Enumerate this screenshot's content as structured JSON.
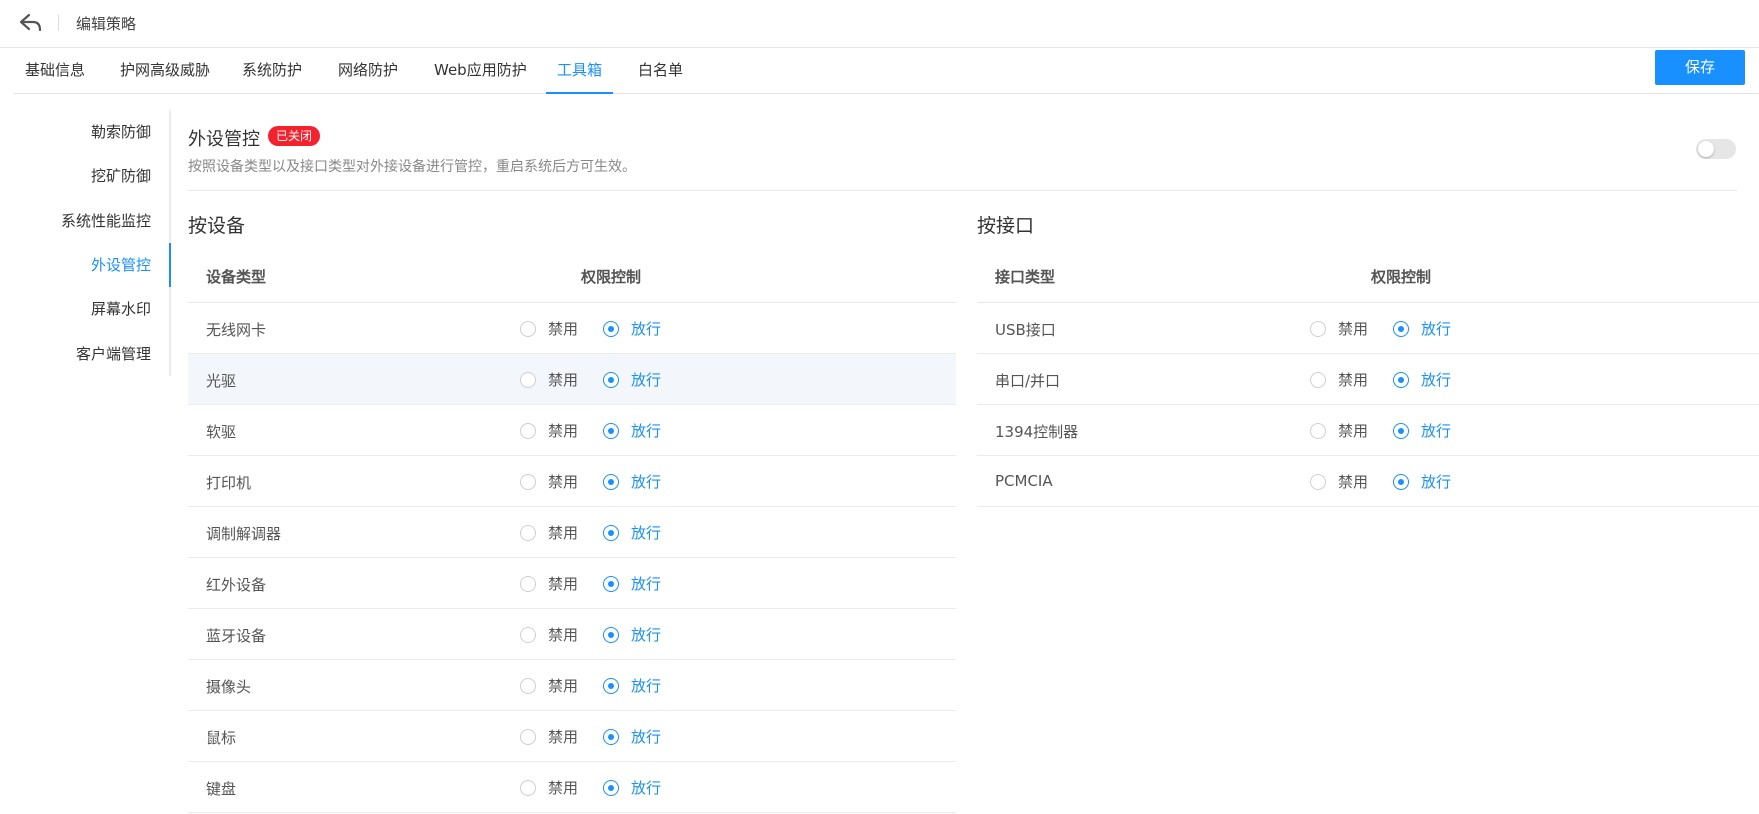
{
  "header": {
    "title": "编辑策略"
  },
  "tabs": [
    {
      "label": "基础信息"
    },
    {
      "label": "护网高级威胁"
    },
    {
      "label": "系统防护"
    },
    {
      "label": "网络防护"
    },
    {
      "label": "Web应用防护"
    },
    {
      "label": "工具箱"
    },
    {
      "label": "白名单"
    }
  ],
  "save_label": "保存",
  "sidemenu": [
    {
      "label": "勒索防御"
    },
    {
      "label": "挖矿防御"
    },
    {
      "label": "系统性能监控"
    },
    {
      "label": "外设管控"
    },
    {
      "label": "屏幕水印"
    },
    {
      "label": "客户端管理"
    }
  ],
  "section": {
    "title": "外设管控",
    "badge": "已关闭",
    "description": "按照设备类型以及接口类型对外接设备进行管控，重启系统后方可生效。"
  },
  "by_device": {
    "title": "按设备",
    "col_type": "设备类型",
    "col_perm": "权限控制",
    "option_deny": "禁用",
    "option_allow": "放行",
    "rows": [
      {
        "name": "无线网卡"
      },
      {
        "name": "光驱"
      },
      {
        "name": "软驱"
      },
      {
        "name": "打印机"
      },
      {
        "name": "调制解调器"
      },
      {
        "name": "红外设备"
      },
      {
        "name": "蓝牙设备"
      },
      {
        "name": "摄像头"
      },
      {
        "name": "鼠标"
      },
      {
        "name": "键盘"
      }
    ]
  },
  "by_port": {
    "title": "按接口",
    "col_type": "接口类型",
    "col_perm": "权限控制",
    "option_deny": "禁用",
    "option_allow": "放行",
    "rows": [
      {
        "name": "USB接口"
      },
      {
        "name": "串口/并口"
      },
      {
        "name": "1394控制器"
      },
      {
        "name": "PCMCIA"
      }
    ]
  },
  "colors": {
    "accent": "#1890ff",
    "badge": "#f5222d"
  }
}
